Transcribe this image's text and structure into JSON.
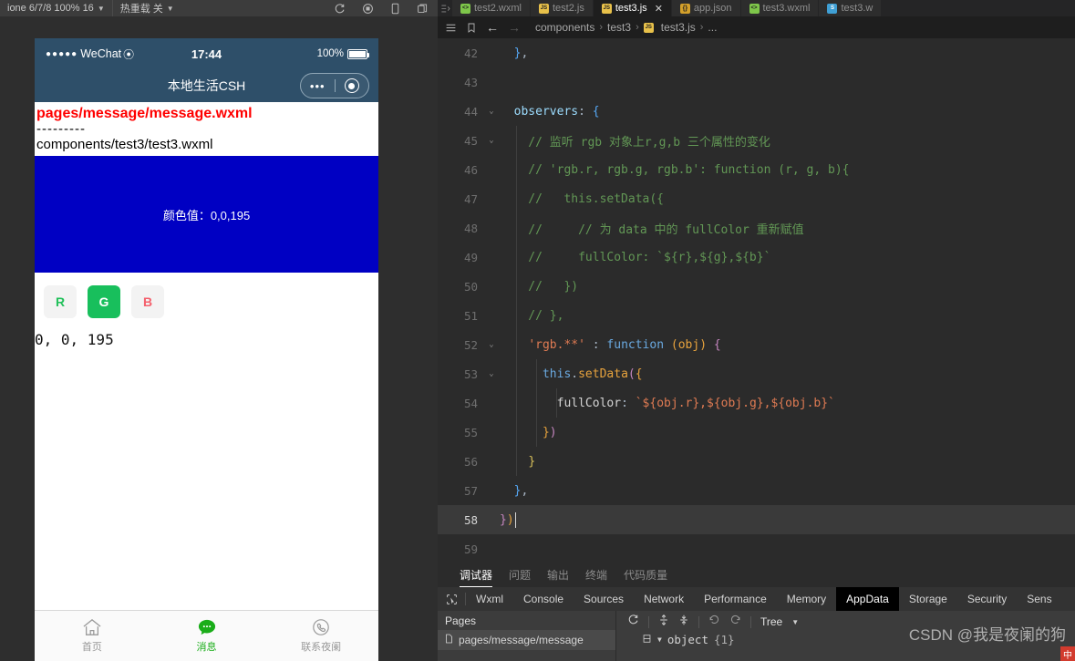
{
  "top_toolbar": {
    "device_label": "ione 6/7/8 100% 16",
    "caret": "▼",
    "hotreload_label": "热重载 关",
    "icons": [
      "refresh-icon",
      "record-icon",
      "phone-icon",
      "copy-icon"
    ]
  },
  "tabbar": {
    "tabs": [
      {
        "label": "test2.wxml",
        "icon": "wxml-file-icon",
        "icon_text": "<>",
        "kind": "wxml",
        "active": false,
        "closable": false
      },
      {
        "label": "test2.js",
        "icon": "js-file-icon",
        "icon_text": "JS",
        "kind": "js",
        "active": false,
        "closable": false
      },
      {
        "label": "test3.js",
        "icon": "js-file-icon",
        "icon_text": "JS",
        "kind": "js",
        "active": true,
        "closable": true
      },
      {
        "label": "app.json",
        "icon": "json-file-icon",
        "icon_text": "{}",
        "kind": "json",
        "active": false,
        "closable": false
      },
      {
        "label": "test3.wxml",
        "icon": "wxml-file-icon",
        "icon_text": "<>",
        "kind": "wxml",
        "active": false,
        "closable": false
      },
      {
        "label": "test3.w",
        "icon": "wxss-file-icon",
        "icon_text": "S",
        "kind": "wxss",
        "active": false,
        "closable": false
      }
    ],
    "close_glyph": "✕"
  },
  "breadcrumb": {
    "back_glyph": "←",
    "forward_glyph": "→",
    "segments": [
      "components",
      "test3",
      "test3.js",
      "..."
    ],
    "file_icon_text": "JS",
    "separator": "›"
  },
  "editor": {
    "lines": [
      {
        "num": "42",
        "fold": "",
        "indent_guides": [],
        "current": false,
        "tokens": [
          {
            "t": "  ",
            "c": "t-punc"
          },
          {
            "t": "}",
            "c": "t-brace-b"
          },
          {
            "t": ",",
            "c": "t-punc"
          }
        ]
      },
      {
        "num": "43",
        "fold": "",
        "indent_guides": [],
        "current": false,
        "tokens": []
      },
      {
        "num": "44",
        "fold": "⌄",
        "indent_guides": [],
        "current": false,
        "tokens": [
          {
            "t": "  ",
            "c": "t-punc"
          },
          {
            "t": "observers",
            "c": "t-key"
          },
          {
            "t": ": ",
            "c": "t-punc"
          },
          {
            "t": "{",
            "c": "t-brace-b"
          }
        ]
      },
      {
        "num": "45",
        "fold": "⌄",
        "indent_guides": [
          86
        ],
        "current": false,
        "tokens": [
          {
            "t": "    // 监听 rgb 对象上r,g,b 三个属性的变化",
            "c": "t-comment"
          }
        ]
      },
      {
        "num": "46",
        "fold": "",
        "indent_guides": [
          86
        ],
        "current": false,
        "tokens": [
          {
            "t": "    // 'rgb.r, rgb.g, rgb.b': function (r, g, b){",
            "c": "t-comment"
          }
        ]
      },
      {
        "num": "47",
        "fold": "",
        "indent_guides": [
          86
        ],
        "current": false,
        "tokens": [
          {
            "t": "    //   this.setData({",
            "c": "t-comment"
          }
        ]
      },
      {
        "num": "48",
        "fold": "",
        "indent_guides": [
          86
        ],
        "current": false,
        "tokens": [
          {
            "t": "    //     // 为 data 中的 fullColor 重新赋值",
            "c": "t-comment"
          }
        ]
      },
      {
        "num": "49",
        "fold": "",
        "indent_guides": [
          86
        ],
        "current": false,
        "tokens": [
          {
            "t": "    //     fullColor: `${r},${g},${b}`",
            "c": "t-comment"
          }
        ]
      },
      {
        "num": "50",
        "fold": "",
        "indent_guides": [
          86
        ],
        "current": false,
        "tokens": [
          {
            "t": "    //   })",
            "c": "t-comment"
          }
        ]
      },
      {
        "num": "51",
        "fold": "",
        "indent_guides": [
          86
        ],
        "current": false,
        "tokens": [
          {
            "t": "    // },",
            "c": "t-comment"
          }
        ]
      },
      {
        "num": "52",
        "fold": "⌄",
        "indent_guides": [
          86
        ],
        "current": false,
        "tokens": [
          {
            "t": "    ",
            "c": "t-punc"
          },
          {
            "t": "'rgb.**'",
            "c": "t-str"
          },
          {
            "t": " : ",
            "c": "t-punc"
          },
          {
            "t": "function",
            "c": "t-fn-kw"
          },
          {
            "t": " (",
            "c": "t-brace-o"
          },
          {
            "t": "obj",
            "c": "t-param"
          },
          {
            "t": ")",
            "c": "t-brace-o"
          },
          {
            "t": " ",
            "c": "t-punc"
          },
          {
            "t": "{",
            "c": "t-brace-p"
          }
        ]
      },
      {
        "num": "53",
        "fold": "⌄",
        "indent_guides": [
          86,
          108
        ],
        "current": false,
        "tokens": [
          {
            "t": "      ",
            "c": "t-punc"
          },
          {
            "t": "this",
            "c": "t-this"
          },
          {
            "t": ".",
            "c": "t-punc"
          },
          {
            "t": "setData",
            "c": "t-method"
          },
          {
            "t": "(",
            "c": "t-brace-p"
          },
          {
            "t": "{",
            "c": "t-brace-o"
          }
        ]
      },
      {
        "num": "54",
        "fold": "",
        "indent_guides": [
          86,
          108,
          130
        ],
        "current": false,
        "tokens": [
          {
            "t": "        ",
            "c": "t-punc"
          },
          {
            "t": "fullColor",
            "c": "t-prop"
          },
          {
            "t": ": ",
            "c": "t-punc"
          },
          {
            "t": "`${obj.r},${obj.g},${obj.b}`",
            "c": "t-str"
          }
        ]
      },
      {
        "num": "55",
        "fold": "",
        "indent_guides": [
          86,
          108
        ],
        "current": false,
        "tokens": [
          {
            "t": "      ",
            "c": "t-punc"
          },
          {
            "t": "}",
            "c": "t-brace-o"
          },
          {
            "t": ")",
            "c": "t-brace-p"
          }
        ]
      },
      {
        "num": "56",
        "fold": "",
        "indent_guides": [
          86
        ],
        "current": false,
        "tokens": [
          {
            "t": "    ",
            "c": "t-punc"
          },
          {
            "t": "}",
            "c": "t-brace-y"
          }
        ]
      },
      {
        "num": "57",
        "fold": "",
        "indent_guides": [],
        "current": false,
        "tokens": [
          {
            "t": "  ",
            "c": "t-punc"
          },
          {
            "t": "}",
            "c": "t-brace-b"
          },
          {
            "t": ",",
            "c": "t-punc"
          }
        ]
      },
      {
        "num": "58",
        "fold": "",
        "indent_guides": [],
        "current": true,
        "tokens": [
          {
            "t": "}",
            "c": "t-brace-p"
          },
          {
            "t": ")",
            "c": "t-brace-o"
          }
        ]
      },
      {
        "num": "59",
        "fold": "",
        "indent_guides": [],
        "current": false,
        "tokens": []
      }
    ]
  },
  "panel_tabs": {
    "tabs": [
      {
        "label": "调试器",
        "active": true
      },
      {
        "label": "问题",
        "active": false
      },
      {
        "label": "输出",
        "active": false
      },
      {
        "label": "终端",
        "active": false
      },
      {
        "label": "代码质量",
        "active": false
      }
    ]
  },
  "devtools": {
    "inspect_icon": "cursor-select-icon",
    "tabs": [
      {
        "label": "Wxml",
        "active": false
      },
      {
        "label": "Console",
        "active": false
      },
      {
        "label": "Sources",
        "active": false
      },
      {
        "label": "Network",
        "active": false
      },
      {
        "label": "Performance",
        "active": false
      },
      {
        "label": "Memory",
        "active": false
      },
      {
        "label": "AppData",
        "active": true
      },
      {
        "label": "Storage",
        "active": false
      },
      {
        "label": "Security",
        "active": false
      },
      {
        "label": "Sens",
        "active": false
      }
    ],
    "pages_title": "Pages",
    "page_item": "pages/message/message",
    "toolbar": {
      "refresh_icon": "refresh-icon",
      "expand_icon": "expand-all-icon",
      "collapse_icon": "collapse-all-icon",
      "undo_icon": "undo-icon",
      "redo_icon": "redo-icon",
      "view_mode": "Tree",
      "view_caret": "▼"
    },
    "tree": {
      "expand_caret": "▼",
      "root_label": "object",
      "root_count": "{1}"
    }
  },
  "watermark": {
    "text": "CSDN @我是夜阑的狗",
    "ime": "中"
  },
  "simulator": {
    "status_bar": {
      "dots": "●●●●●",
      "carrier": "WeChat",
      "wifi": "⦿",
      "time": "17:44",
      "battery_text": "100%"
    },
    "nav": {
      "title": "本地生活CSH",
      "dots": "•••",
      "target_icon": "target-icon"
    },
    "page": {
      "line1": "pages/message/message.wxml",
      "dashes": "---------",
      "line2": "components/test3/test3.wxml",
      "color_block": {
        "bg": "#0000c3",
        "label": "颜色值：0,0,195"
      },
      "buttons": [
        {
          "label": "R",
          "bg": "#f3f3f3",
          "fg": "#21c05a"
        },
        {
          "label": "G",
          "bg": "#18bf5c",
          "fg": "#ffffff"
        },
        {
          "label": "B",
          "bg": "#f3f3f3",
          "fg": "#f4606c"
        }
      ],
      "values": "0, 0, 195"
    },
    "tabbar": [
      {
        "label": "首页",
        "icon": "home-icon",
        "active": false
      },
      {
        "label": "消息",
        "icon": "message-icon",
        "active": true
      },
      {
        "label": "联系夜阑",
        "icon": "phone-icon",
        "active": false
      }
    ]
  }
}
